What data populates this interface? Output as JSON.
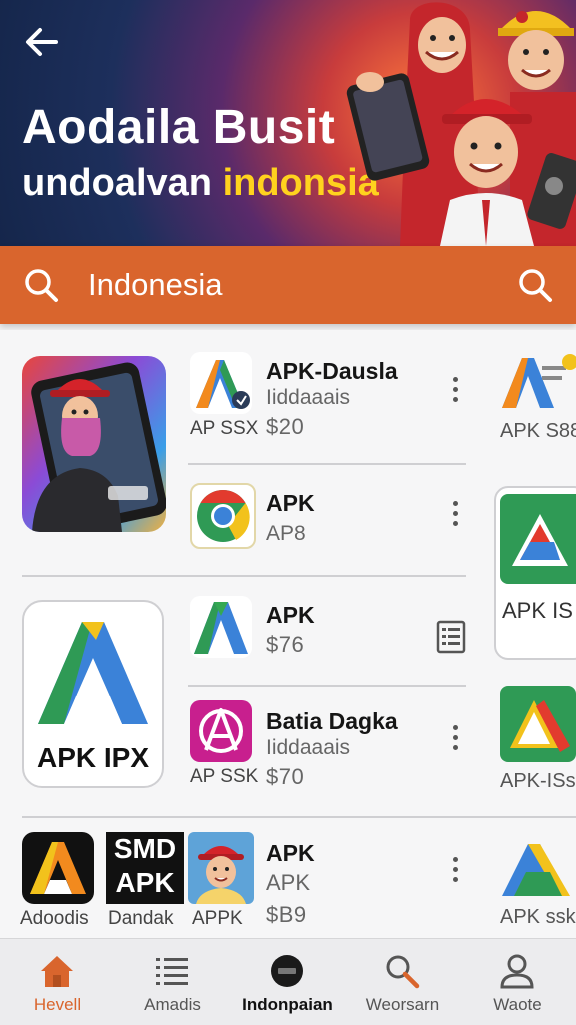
{
  "header": {
    "title_line1": "Aodaila Busit",
    "title_line2_part1": "undoalvan ",
    "title_line2_highlight": "indonsia"
  },
  "search": {
    "value": "Indonesia"
  },
  "content": {
    "rows": [
      {
        "title": "APK-Dausla",
        "subtitle": "Iiddaaais",
        "price": "$20",
        "icon_label": "AP SSX",
        "icon": "apk-a-icon"
      },
      {
        "title": "APK",
        "subtitle": "AP8",
        "icon": "chrome-icon"
      },
      {
        "title": "APK",
        "price": "$76",
        "icon": "apk-a-icon"
      },
      {
        "title": "Batia Dagka",
        "subtitle": "Iiddaaais",
        "price": "$70",
        "icon_label": "AP SSK",
        "icon": "magenta-a-icon"
      },
      {
        "title": "APK",
        "subtitle": "APK",
        "price": "$B9",
        "icon_label": "APPK",
        "icon": "avatar-icon"
      }
    ],
    "featured_card_label": "APK IPX",
    "bottom_row_labels": [
      "Adoodis",
      "Dandak"
    ],
    "smd_text": [
      "SMD",
      "APK"
    ],
    "side_labels": [
      "APK S88",
      "APK IS",
      "APK-ISs",
      "APK ssk"
    ]
  },
  "bottom_nav": {
    "items": [
      {
        "label": "Hevell",
        "icon": "home-icon",
        "active": true
      },
      {
        "label": "Amadis",
        "icon": "list-icon"
      },
      {
        "label": "Indonpaian",
        "icon": "badge-icon"
      },
      {
        "label": "Weorsarn",
        "icon": "search-icon"
      },
      {
        "label": "Waote",
        "icon": "profile-icon"
      }
    ]
  },
  "colors": {
    "accent": "#d9652d",
    "highlight": "#ffd21e",
    "hero_dark": "#15264b"
  }
}
